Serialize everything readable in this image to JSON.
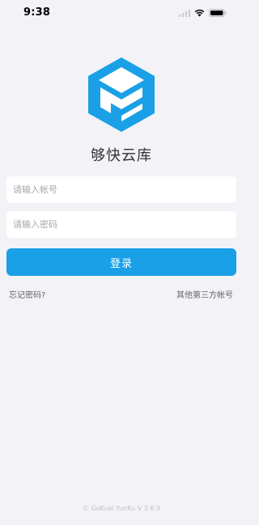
{
  "status_bar": {
    "time": "9:38"
  },
  "app": {
    "name": "够快云库",
    "logo_color": "#1aa0e6"
  },
  "form": {
    "account_placeholder": "请输入帐号",
    "password_placeholder": "请输入密码",
    "login_label": "登录"
  },
  "links": {
    "forgot_password": "忘记密码?",
    "third_party": "其他第三方帐号"
  },
  "footer": {
    "version": "© GoKuai YunKu V 3.6.9"
  },
  "colors": {
    "background": "#f2f2f7",
    "accent": "#1aa0e6",
    "link_text": "#666666"
  },
  "icons": [
    "signal-icon",
    "wifi-icon",
    "battery-icon",
    "app-logo-icon"
  ]
}
